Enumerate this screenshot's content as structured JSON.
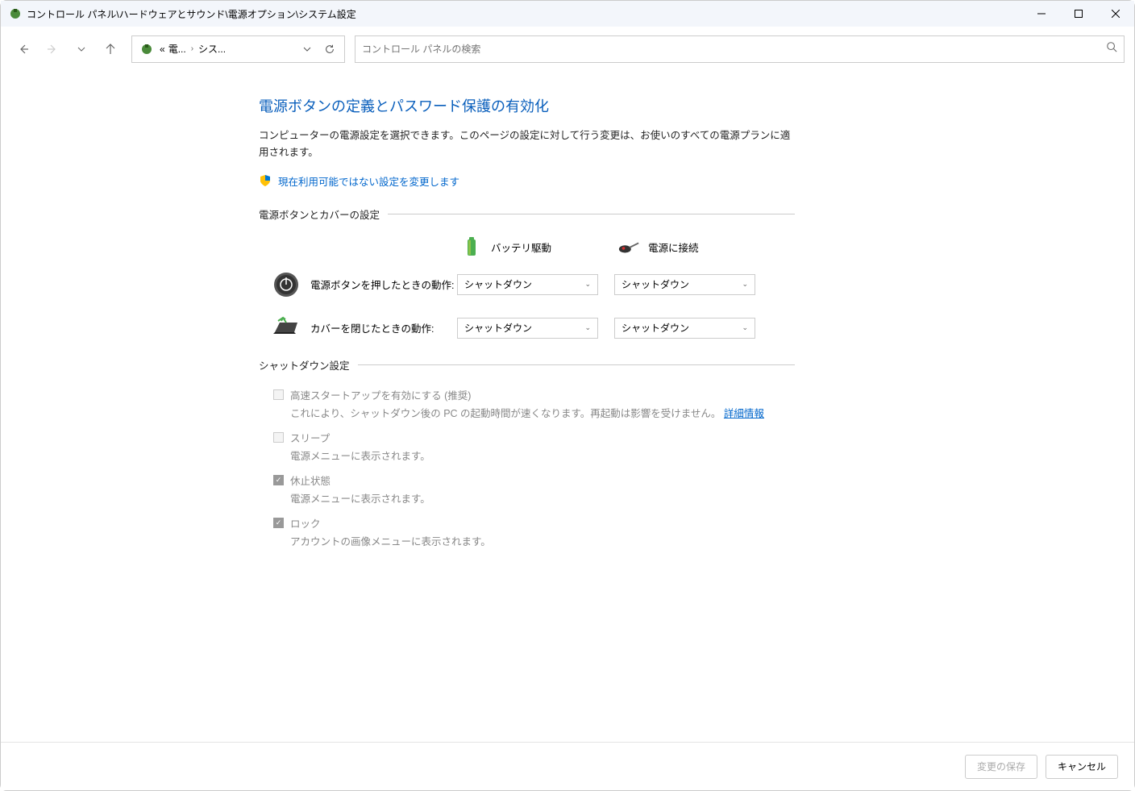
{
  "window": {
    "title": "コントロール パネル\\ハードウェアとサウンド\\電源オプション\\システム設定"
  },
  "breadcrumb": {
    "prefix": "«",
    "item1": "電...",
    "sep": "›",
    "item2": "シス..."
  },
  "search": {
    "placeholder": "コントロール パネルの検索"
  },
  "page": {
    "title": "電源ボタンの定義とパスワード保護の有効化",
    "description": "コンピューターの電源設定を選択できます。このページの設定に対して行う変更は、お使いのすべての電源プランに適用されます。",
    "uac_link": "現在利用可能ではない設定を変更します"
  },
  "sections": {
    "power_button": "電源ボタンとカバーの設定",
    "shutdown": "シャットダウン設定"
  },
  "columns": {
    "battery": "バッテリ駆動",
    "plugged": "電源に接続"
  },
  "rows": {
    "power_button": {
      "label": "電源ボタンを押したときの動作:",
      "battery": "シャットダウン",
      "plugged": "シャットダウン"
    },
    "lid": {
      "label": "カバーを閉じたときの動作:",
      "battery": "シャットダウン",
      "plugged": "シャットダウン"
    }
  },
  "shutdown_items": {
    "fast_startup": {
      "label": "高速スタートアップを有効にする (推奨)",
      "desc_prefix": "これにより、シャットダウン後の PC の起動時間が速くなります。再起動は影響を受けません。",
      "link": "詳細情報"
    },
    "sleep": {
      "label": "スリープ",
      "desc": "電源メニューに表示されます。"
    },
    "hibernate": {
      "label": "休止状態",
      "desc": "電源メニューに表示されます。"
    },
    "lock": {
      "label": "ロック",
      "desc": "アカウントの画像メニューに表示されます。"
    }
  },
  "footer": {
    "save": "変更の保存",
    "cancel": "キャンセル"
  }
}
